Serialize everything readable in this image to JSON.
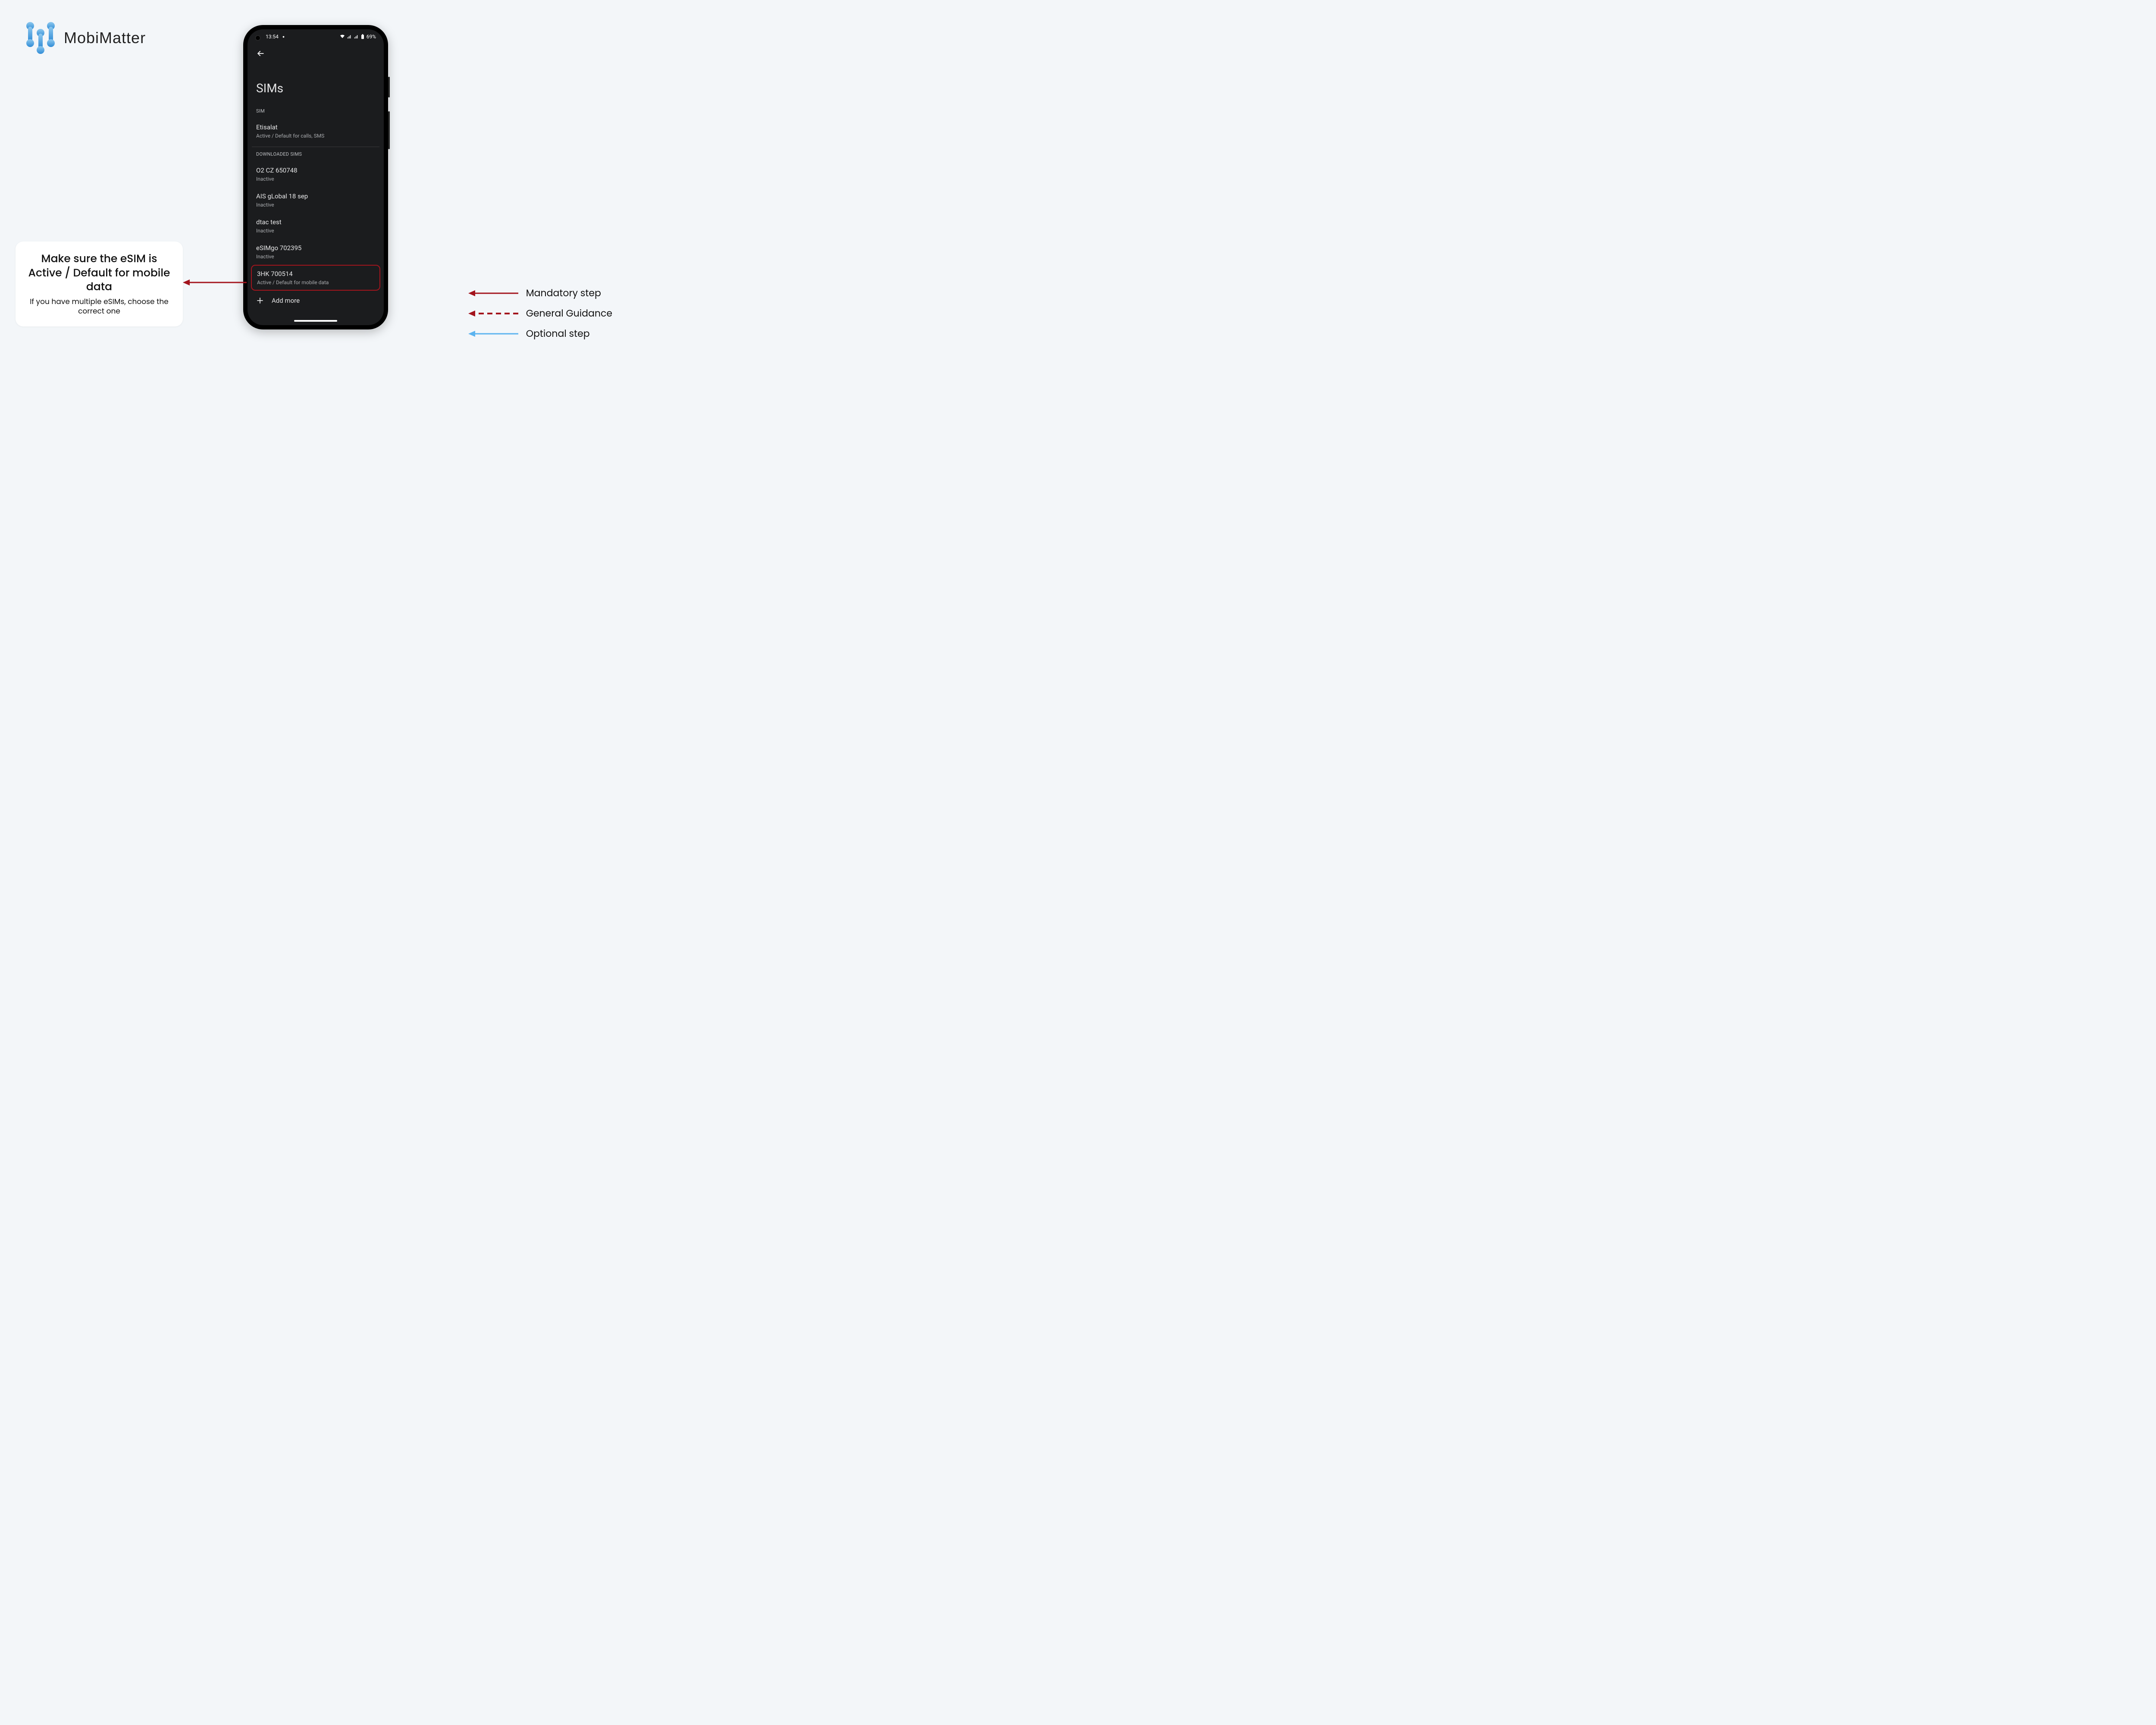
{
  "logo": {
    "text": "MobiMatter"
  },
  "callout": {
    "title": "Make sure the eSIM is Active / Default for mobile data",
    "sub": "If you have multiple eSIMs, choose the correct one"
  },
  "legend": {
    "mandatory": "Mandatory step",
    "guidance": "General Guidance",
    "optional": "Optional step"
  },
  "phone": {
    "statusbar": {
      "time": "13:54",
      "battery": "69%"
    },
    "back_icon": "←",
    "page_title": "SIMs",
    "sim_section": {
      "label": "SIM",
      "item": {
        "name": "Etisalat",
        "sub": "Active / Default for calls, SMS"
      }
    },
    "downloaded_section": {
      "label": "DOWNLOADED SIMS",
      "items": [
        {
          "name": "O2 CZ 650748",
          "sub": "Inactive"
        },
        {
          "name": "AIS gLobal 18 sep",
          "sub": "Inactive"
        },
        {
          "name": "dtac test",
          "sub": "Inactive"
        },
        {
          "name": "eSIMgo 702395",
          "sub": "Inactive"
        }
      ],
      "highlighted": {
        "name": "3HK 700514",
        "sub": "Active / Default for mobile data"
      }
    },
    "add_more": "Add more"
  }
}
